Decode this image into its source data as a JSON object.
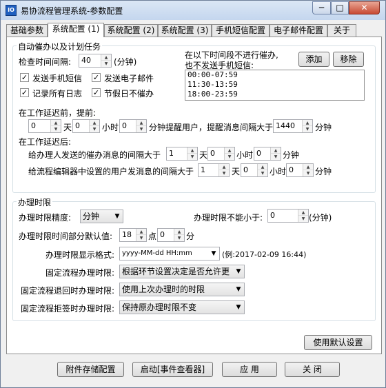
{
  "window": {
    "title": "易协流程管理系统-参数配置",
    "icon": "app-logo-icon",
    "min": "─",
    "max": "□",
    "close": "✕"
  },
  "tabs": [
    {
      "label": "基础参数"
    },
    {
      "label": "系统配置 (1)"
    },
    {
      "label": "系统配置 (2)"
    },
    {
      "label": "系统配置 (3)"
    },
    {
      "label": "手机短信配置"
    },
    {
      "label": "电子邮件配置"
    },
    {
      "label": "关于"
    }
  ],
  "auto_task": {
    "title": "自动催办以及计划任务",
    "interval_label": "检查时间间隔:",
    "interval_value": "40",
    "interval_unit": "(分钟)",
    "checks": [
      {
        "label": "发送手机短信",
        "checked": "✓"
      },
      {
        "label": "发送电子邮件",
        "checked": "✓"
      },
      {
        "label": "记录所有日志",
        "checked": "✓"
      },
      {
        "label": "节假日不催办",
        "checked": "✓"
      }
    ],
    "no_sms_label1": "在以下时间段不进行催办,",
    "no_sms_label2": "也不发送手机短信:",
    "add_button": "添加",
    "remove_button": "移除",
    "periods": [
      "00:00-07:59",
      "11:30-13:59",
      "18:00-23:59"
    ],
    "before_delay_label": "在工作延迟前，提前:",
    "before": {
      "days": "0",
      "hours": "0",
      "minutes": "0",
      "interval": "1440"
    },
    "day_unit": "天",
    "hour_unit": "小时",
    "minute_unit": "分钟",
    "remind_text": "分钟提醒用户，提醒消息间隔大于",
    "after_delay_label": "在工作延迟后:",
    "handler_label": "给办理人发送的催办消息的间隔大于",
    "handler": {
      "days": "1",
      "hours": "0",
      "minutes": "0"
    },
    "editor_label": "给流程编辑器中设置的用户发消息的间隔大于",
    "editor": {
      "days": "1",
      "hours": "0",
      "minutes": "0"
    }
  },
  "time_limit": {
    "title": "办理时限",
    "precision_label": "办理时限精度:",
    "precision_value": "分钟",
    "min_label": "办理时限不能小于:",
    "min_value": "0",
    "min_unit": "(分钟)",
    "default_label": "办理时限时间部分默认值:",
    "default_hour": "18",
    "hour_unit": "点",
    "default_minute": "0",
    "minute_unit": "分",
    "format_label": "办理时限显示格式:",
    "format_value": "yyyy-MM-dd HH:mm",
    "format_example": "(例:2017-02-09 16:44)",
    "fixed_label": "固定流程办理时限:",
    "fixed_value": "根据环节设置决定是否允许更",
    "return_label": "固定流程退回时办理时限:",
    "return_value": "使用上次办理时的时限",
    "reject_label": "固定流程拒签时办理时限:",
    "reject_value": "保持原办理时限不变"
  },
  "default_button": "使用默认设置",
  "footer": {
    "attach_button": "附件存储配置",
    "start_button": "启动[事件查看器]",
    "apply_button": "应 用",
    "close_button": "关 闭"
  },
  "glyphs": {
    "up": "▲",
    "down": "▼"
  }
}
